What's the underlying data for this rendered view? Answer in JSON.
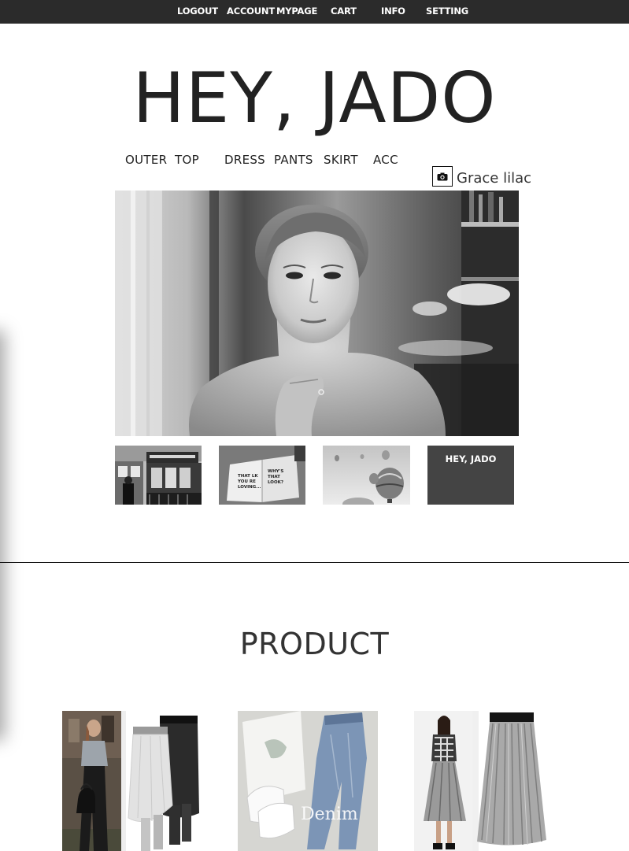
{
  "topnav": {
    "items": [
      {
        "label": "LOGOUT"
      },
      {
        "label": "ACCOUNT"
      },
      {
        "label": "MYPAGE"
      },
      {
        "label": "CART"
      },
      {
        "label": "INFO"
      },
      {
        "label": "SETTING"
      }
    ]
  },
  "brand": {
    "title": "HEY, JADO"
  },
  "categories": [
    {
      "label": "OUTER"
    },
    {
      "label": "TOP"
    },
    {
      "label": "DRESS"
    },
    {
      "label": "PANTS"
    },
    {
      "label": "SKIRT"
    },
    {
      "label": "ACC"
    }
  ],
  "photo_credit": {
    "icon": "camera-icon",
    "label": "Grace lilac"
  },
  "hero": {
    "icon": "portrait-photo"
  },
  "thumbnails": [
    {
      "icon": "street-photo"
    },
    {
      "icon": "book-photo",
      "text": "THAT LK YOU RE LOVING ... WHY'S THAT LOOK?"
    },
    {
      "icon": "balloons-photo"
    },
    {
      "icon": "brand-tile",
      "label": "HEY, JADO"
    }
  ],
  "product_section": {
    "title": "PRODUCT"
  },
  "products": [
    {
      "icon": "layered-skirt-leggings-photo"
    },
    {
      "icon": "denim-flatlay-photo",
      "caption": "Denim"
    },
    {
      "icon": "pleated-skirt-photo"
    }
  ]
}
